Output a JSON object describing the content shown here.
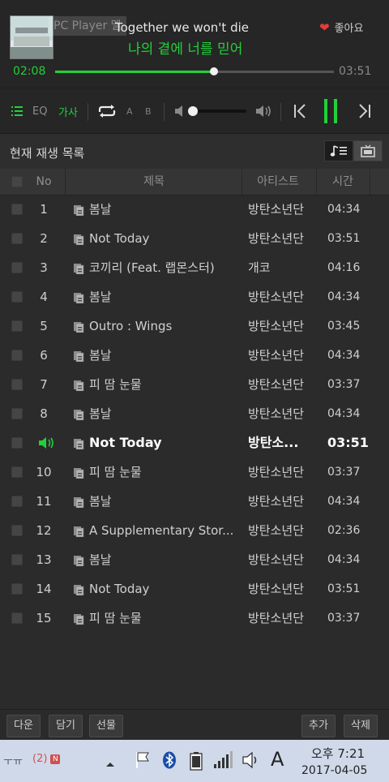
{
  "now_playing": {
    "watermark": "PC Player 멜",
    "title": "Together we won't die",
    "lyric": "나의 곁에 너를 믿어",
    "like_label": "좋아요",
    "current_time": "02:08",
    "total_time": "03:51",
    "progress": 0.57
  },
  "controls": {
    "eq_label": "EQ",
    "lyrics_label": "가사",
    "ab_label": "A B",
    "volume": 0.05,
    "accent": "#23cf3b"
  },
  "playlist": {
    "title": "현재 재생 목록",
    "columns": {
      "no": "No",
      "title": "제목",
      "artist": "아티스트",
      "time": "시간"
    },
    "rows": [
      {
        "no": "1",
        "title": "봄날",
        "artist": "방탄소년단",
        "time": "04:34",
        "playing": false
      },
      {
        "no": "2",
        "title": "Not Today",
        "artist": "방탄소년단",
        "time": "03:51",
        "playing": false
      },
      {
        "no": "3",
        "title": "코끼리 (Feat. 랩몬스터)",
        "artist": "개코",
        "time": "04:16",
        "playing": false
      },
      {
        "no": "4",
        "title": "봄날",
        "artist": "방탄소년단",
        "time": "04:34",
        "playing": false
      },
      {
        "no": "5",
        "title": "Outro : Wings",
        "artist": "방탄소년단",
        "time": "03:45",
        "playing": false
      },
      {
        "no": "6",
        "title": "봄날",
        "artist": "방탄소년단",
        "time": "04:34",
        "playing": false
      },
      {
        "no": "7",
        "title": "피 땀 눈물",
        "artist": "방탄소년단",
        "time": "03:37",
        "playing": false
      },
      {
        "no": "8",
        "title": "봄날",
        "artist": "방탄소년단",
        "time": "04:34",
        "playing": false
      },
      {
        "no": "",
        "title": "Not Today",
        "artist": "방탄소...",
        "time": "03:51",
        "playing": true
      },
      {
        "no": "10",
        "title": "피 땀 눈물",
        "artist": "방탄소년단",
        "time": "03:37",
        "playing": false
      },
      {
        "no": "11",
        "title": "봄날",
        "artist": "방탄소년단",
        "time": "04:34",
        "playing": false
      },
      {
        "no": "12",
        "title": "A Supplementary Stor...",
        "artist": "방탄소년단",
        "time": "02:36",
        "playing": false
      },
      {
        "no": "13",
        "title": "봄날",
        "artist": "방탄소년단",
        "time": "04:34",
        "playing": false
      },
      {
        "no": "14",
        "title": "Not Today",
        "artist": "방탄소년단",
        "time": "03:51",
        "playing": false
      },
      {
        "no": "15",
        "title": "피 땀 눈물",
        "artist": "방탄소년단",
        "time": "03:37",
        "playing": false
      }
    ]
  },
  "bottom_buttons": {
    "download": "다운",
    "save": "담기",
    "gift": "선물",
    "add": "추가",
    "delete": "삭제"
  },
  "taskbar": {
    "left_text": "ㅜㅠ",
    "notify_count": "(2)",
    "notify_badge": "N",
    "ime": "A",
    "time": "오후 7:21",
    "date": "2017-04-05"
  }
}
